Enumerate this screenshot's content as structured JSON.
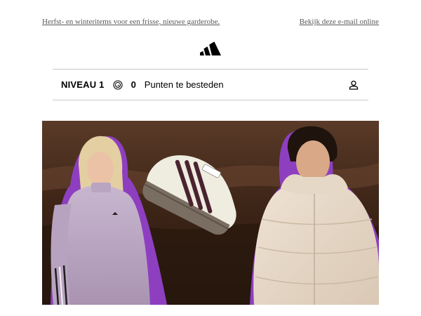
{
  "preheader": {
    "left_text": "Herfst- en winteritems voor een frisse, nieuwe garderobe.",
    "right_link": "Bekijk deze e-mail online"
  },
  "brand": {
    "logo_icon": "adidas-performance-logo",
    "color": "#000000"
  },
  "loyalty_bar": {
    "level": "NIVEAU 1",
    "coin_icon": "points-coin-icon",
    "points": "0",
    "points_label": "Punten te besteden",
    "account_icon": "user-account-icon"
  },
  "hero": {
    "image": "hero-banner-woman-sneaker-man",
    "accent_color": "#8e3fc0"
  }
}
